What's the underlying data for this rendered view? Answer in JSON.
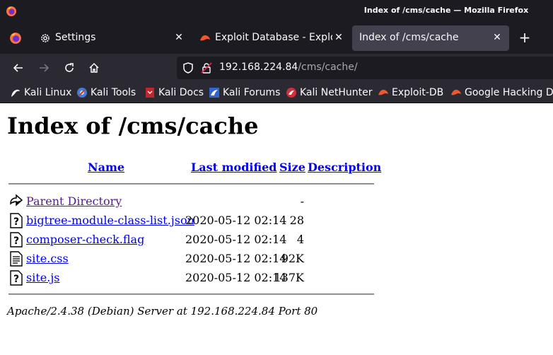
{
  "window": {
    "title": "Index of /cms/cache — Mozilla Firefox"
  },
  "tabs": [
    {
      "label": "Settings",
      "icon": "gear-icon",
      "active": false
    },
    {
      "label": "Exploit Database - Exploit",
      "icon": "exploit-db-icon",
      "active": false
    },
    {
      "label": "Index of /cms/cache",
      "icon": "",
      "active": true
    }
  ],
  "urlbar": {
    "host": "192.168.224.84",
    "path": "/cms/cache/"
  },
  "bookmarks": [
    {
      "label": "Kali Linux",
      "icon": "kali-dragon-icon"
    },
    {
      "label": "Kali Tools",
      "icon": "kali-tools-icon"
    },
    {
      "label": "Kali Docs",
      "icon": "kali-docs-icon"
    },
    {
      "label": "Kali Forums",
      "icon": "kali-forums-icon"
    },
    {
      "label": "Kali NetHunter",
      "icon": "kali-nethunter-icon"
    },
    {
      "label": "Exploit-DB",
      "icon": "exploit-db-icon"
    },
    {
      "label": "Google Hacking DB",
      "icon": "ghdb-icon"
    }
  ],
  "page": {
    "heading": "Index of /cms/cache",
    "columns": {
      "name": "Name",
      "last_modified": "Last modified",
      "size": "Size",
      "description": "Description"
    },
    "rows": [
      {
        "name": "Parent Directory",
        "date": "",
        "size": "-",
        "icon": "parent-directory-icon"
      },
      {
        "name": "bigtree-module-class-list.json",
        "date": "2020-05-12 02:14",
        "size": "28",
        "icon": "unknown-file-icon"
      },
      {
        "name": "composer-check.flag",
        "date": "2020-05-12 02:14",
        "size": "4",
        "icon": "unknown-file-icon"
      },
      {
        "name": "site.css",
        "date": "2020-05-12 02:14",
        "size": "92K",
        "icon": "text-file-icon"
      },
      {
        "name": "site.js",
        "date": "2020-05-12 02:14",
        "size": "137K",
        "icon": "unknown-file-icon"
      }
    ],
    "address": "Apache/2.4.38 (Debian) Server at 192.168.224.84 Port 80"
  },
  "colors": {
    "chrome_dark": "#1c1b22",
    "toolbar": "#2b2a33",
    "active_tab": "#42414d",
    "link": "#0000ee",
    "visited_link": "#551a8b"
  }
}
